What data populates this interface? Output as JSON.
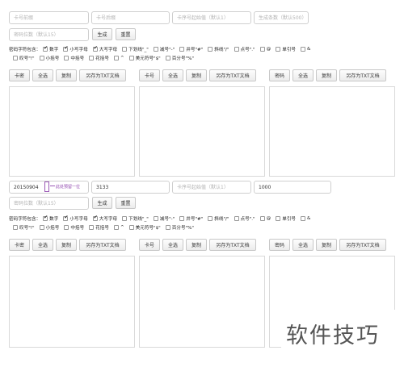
{
  "form1": {
    "prefix_placeholder": "卡号前缀",
    "suffix_placeholder": "卡号后缀",
    "start_placeholder": "卡序号起始值（默认1）",
    "count_placeholder": "生成条数（默认500）",
    "pwlen_placeholder": "密码位数（默认15）",
    "generate": "生成",
    "reset": "重置"
  },
  "form2": {
    "prefix_value": "20150904",
    "suffix_value": "3133",
    "start_placeholder": "卡序号起始值（默认1）",
    "count_value": "1000",
    "pwlen_placeholder": "密码位数（默认15）",
    "generate": "生成",
    "reset": "重置",
    "annotation": "此处预留一位"
  },
  "charset": {
    "label": "密码字符包含：",
    "row1": [
      {
        "label": "数字",
        "checked": true
      },
      {
        "label": "小写字母",
        "checked": true
      },
      {
        "label": "大写字母",
        "checked": true
      },
      {
        "label": "下划线\"_\"",
        "checked": false
      },
      {
        "label": "减号\"-\"",
        "checked": false
      },
      {
        "label": "井号\"#\"",
        "checked": false
      },
      {
        "label": "斜线\"/\"",
        "checked": false
      },
      {
        "label": "点号\".\"",
        "checked": false
      },
      {
        "label": "@",
        "checked": false
      },
      {
        "label": "单引号",
        "checked": false
      },
      {
        "label": "&",
        "checked": false
      }
    ],
    "row2": [
      {
        "label": "叹号\"!\"",
        "checked": false
      },
      {
        "label": "小括号",
        "checked": false
      },
      {
        "label": "中括号",
        "checked": false
      },
      {
        "label": "花括号",
        "checked": false
      },
      {
        "label": "^",
        "checked": false
      },
      {
        "label": "美元符号\"$\"",
        "checked": false
      },
      {
        "label": "百分号\"%\"",
        "checked": false
      }
    ]
  },
  "toolbars": {
    "card_secret": "卡密",
    "card_number": "卡号",
    "password": "密码",
    "select_all": "全选",
    "copy": "复制",
    "save_txt": "另存为TXT文档"
  },
  "watermark": "软件技巧"
}
